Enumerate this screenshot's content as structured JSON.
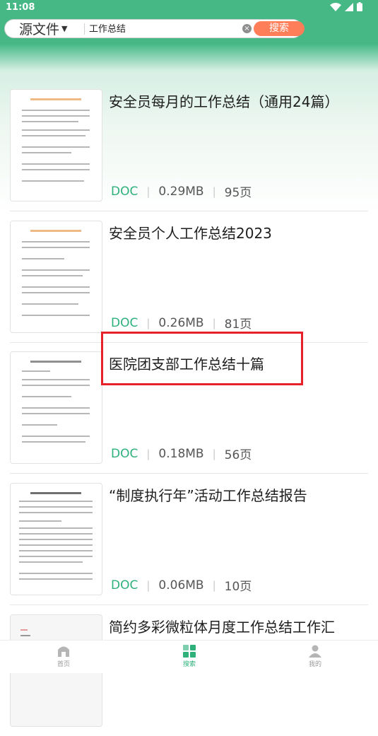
{
  "status_bar": {
    "time": "11:08"
  },
  "search": {
    "source_label": "源文件",
    "query": "工作总结",
    "search_button": "搜索"
  },
  "results": [
    {
      "title": "安全员每月的工作总结（通用24篇）",
      "type": "DOC",
      "size": "0.29MB",
      "pages": "95页"
    },
    {
      "title": "安全员个人工作总结2023",
      "type": "DOC",
      "size": "0.26MB",
      "pages": "81页"
    },
    {
      "title": "医院团支部工作总结十篇",
      "type": "DOC",
      "size": "0.18MB",
      "pages": "56页"
    },
    {
      "title": "“制度执行年”活动工作总结报告",
      "type": "DOC",
      "size": "0.06MB",
      "pages": "10页"
    },
    {
      "title": "简约多彩微粒体月度工作总结工作汇",
      "type": "",
      "size": "",
      "pages": ""
    }
  ],
  "bottom_nav": [
    {
      "label": "首页",
      "icon": "home-icon"
    },
    {
      "label": "搜索",
      "icon": "grid-icon"
    },
    {
      "label": "我的",
      "icon": "user-icon"
    }
  ],
  "colors": {
    "brand": "#45b886",
    "accent": "#ff7e5a",
    "doc_type": "#2eb07b",
    "highlight": "#e8202a"
  }
}
